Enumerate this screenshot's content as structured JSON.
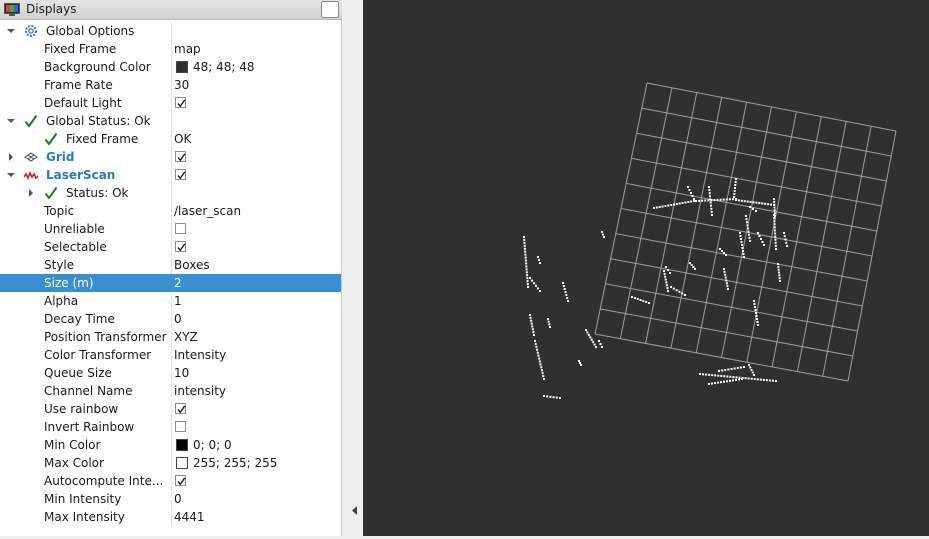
{
  "panel": {
    "title": "Displays"
  },
  "rows": [
    {
      "depth": 0,
      "arrow": "expanded",
      "icon": "gear-icon",
      "label": "Global Options",
      "bold": false
    },
    {
      "depth": 1,
      "label": "Fixed Frame",
      "value": "map"
    },
    {
      "depth": 1,
      "label": "Background Color",
      "swatch": "#303030",
      "value": "48; 48; 48"
    },
    {
      "depth": 1,
      "label": "Frame Rate",
      "value": "30"
    },
    {
      "depth": 1,
      "label": "Default Light",
      "checkbox": true
    },
    {
      "depth": 0,
      "arrow": "expanded",
      "icon": "ok-check-icon",
      "label": "Global Status: Ok"
    },
    {
      "depth": 1,
      "icon": "ok-check-icon",
      "label": "Fixed Frame",
      "value": "OK"
    },
    {
      "depth": 0,
      "arrow": "collapsed",
      "icon": "grid-icon",
      "label": "Grid",
      "bold": true,
      "checkbox": true
    },
    {
      "depth": 0,
      "arrow": "expanded",
      "icon": "laserscan-icon",
      "label": "LaserScan",
      "bold": true,
      "checkbox": true
    },
    {
      "depth": 1,
      "arrow": "collapsed",
      "icon": "ok-check-icon",
      "label": "Status: Ok"
    },
    {
      "depth": 1,
      "label": "Topic",
      "value": "/laser_scan"
    },
    {
      "depth": 1,
      "label": "Unreliable",
      "checkbox": false
    },
    {
      "depth": 1,
      "label": "Selectable",
      "checkbox": true
    },
    {
      "depth": 1,
      "label": "Style",
      "value": "Boxes"
    },
    {
      "depth": 1,
      "label": "Size (m)",
      "value": "2",
      "selected": true
    },
    {
      "depth": 1,
      "label": "Alpha",
      "value": "1"
    },
    {
      "depth": 1,
      "label": "Decay Time",
      "value": "0"
    },
    {
      "depth": 1,
      "label": "Position Transformer",
      "value": "XYZ"
    },
    {
      "depth": 1,
      "label": "Color Transformer",
      "value": "Intensity"
    },
    {
      "depth": 1,
      "label": "Queue Size",
      "value": "10"
    },
    {
      "depth": 1,
      "label": "Channel Name",
      "value": "intensity"
    },
    {
      "depth": 1,
      "label": "Use rainbow",
      "checkbox": true
    },
    {
      "depth": 1,
      "label": "Invert Rainbow",
      "checkbox": false
    },
    {
      "depth": 1,
      "label": "Min Color",
      "swatch": "#000000",
      "value": "0; 0; 0"
    },
    {
      "depth": 1,
      "label": "Max Color",
      "swatch": "#ffffff",
      "value": "255; 255; 255"
    },
    {
      "depth": 1,
      "label": "Autocompute Inte...",
      "checkbox": true
    },
    {
      "depth": 1,
      "label": "Min Intensity",
      "value": "0"
    },
    {
      "depth": 1,
      "label": "Max Intensity",
      "value": "4441"
    }
  ],
  "colors": {
    "viewport_background": "#303030",
    "selection": "#3a8fd1",
    "accent_label": "#2e78c0",
    "ok_green": "#1e7a1e",
    "grid_line": "#a0a0a0",
    "scan_point": "#ffffff"
  }
}
